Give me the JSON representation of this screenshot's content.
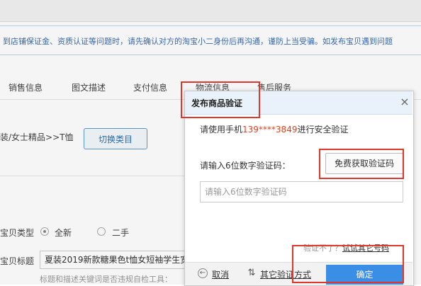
{
  "background": {
    "notice": "到店铺保证金、资质认证等问题时，请先确认对方的淘宝小二身份后再沟通，谨防上当受骗。如发布宝贝遇到问题",
    "tabs": [
      "销售信息",
      "图文描述",
      "支付信息",
      "物流信息",
      "售后服务"
    ],
    "category_path": "装/女士精品>>T恤",
    "switch_category_button": "切换类目",
    "item_type_label": "宝贝类型",
    "item_type_options": [
      "全新",
      "二手"
    ],
    "item_title_label": "宝贝标题",
    "item_title_value": "夏装2019新款糖果色t恤女短袖学生宽",
    "title_hint": "标题和描述关键词是否违规自检工具："
  },
  "modal": {
    "title": "发布商品验证",
    "close_symbol": "×",
    "phone_prefix": "请使用手机",
    "phone_number": "139****3849",
    "phone_suffix": "进行安全验证",
    "code_label": "请输入6位数字验证码：",
    "get_code_button": "免费获取验证码",
    "code_placeholder": "请输入6位数字验证码",
    "unavailable_text": "验证不了？",
    "try_other_phone": "试试其它号码",
    "cancel_label": "取消",
    "other_method_label": "其它验证方式",
    "confirm_label": "确定"
  },
  "icons": {
    "back": "back-arrow-icon",
    "switch": "switch-sync-icon",
    "close": "close-icon"
  },
  "colors": {
    "accent": "#3a8ee6",
    "phone_highlight": "#e0401c",
    "annotation_red": "#e0362c",
    "notice_text": "#3a6cb3"
  }
}
